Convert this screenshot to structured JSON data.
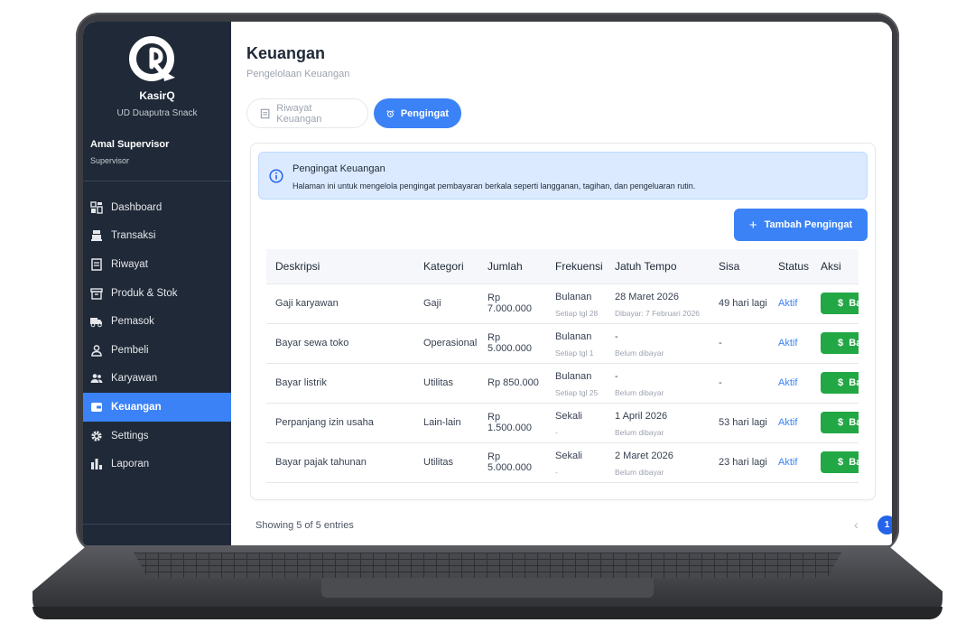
{
  "brand": {
    "name": "KasirQ",
    "subtitle": "UD Duaputra Snack"
  },
  "user": {
    "name": "Amal Supervisor",
    "role": "Supervisor"
  },
  "sidebar": {
    "items": [
      {
        "label": "Dashboard",
        "icon": "dashboard-icon"
      },
      {
        "label": "Transaksi",
        "icon": "cash-register-icon"
      },
      {
        "label": "Riwayat",
        "icon": "receipt-icon"
      },
      {
        "label": "Produk & Stok",
        "icon": "box-icon"
      },
      {
        "label": "Pemasok",
        "icon": "truck-icon"
      },
      {
        "label": "Pembeli",
        "icon": "user-icon"
      },
      {
        "label": "Karyawan",
        "icon": "users-icon"
      },
      {
        "label": "Keuangan",
        "icon": "wallet-icon",
        "active": true
      },
      {
        "label": "Settings",
        "icon": "gear-icon"
      },
      {
        "label": "Laporan",
        "icon": "bar-chart-icon"
      }
    ]
  },
  "page": {
    "title": "Keuangan",
    "subtitle": "Pengelolaan Keuangan"
  },
  "tabs": {
    "riwayat": "Riwayat Keuangan",
    "pengingat": "Pengingat"
  },
  "alert": {
    "title": "Pengingat Keuangan",
    "text": "Halaman ini untuk mengelola pengingat pembayaran berkala seperti langganan, tagihan, dan pengeluaran rutin."
  },
  "add_button": {
    "label": "Tambah Pengingat"
  },
  "table": {
    "headers": [
      "Deskripsi",
      "Kategori",
      "Jumlah",
      "Frekuensi",
      "Jatuh Tempo",
      "Sisa",
      "Status",
      "Aksi"
    ],
    "rows": [
      {
        "deskripsi": "Gaji karyawan",
        "kategori": "Gaji",
        "jumlah": "Rp 7.000.000",
        "frekuensi": "Bulanan",
        "frekuensi_detail": "Setiap tgl 28",
        "jatuh_tempo": "28 Maret 2026",
        "jatuh_tempo_detail": "Dibayar: 7 Februari 2026",
        "sisa": "49 hari lagi",
        "status": "Aktif",
        "aksi": "Ba"
      },
      {
        "deskripsi": "Bayar sewa toko",
        "kategori": "Operasional",
        "jumlah": "Rp 5.000.000",
        "frekuensi": "Bulanan",
        "frekuensi_detail": "Setiap tgl 1",
        "jatuh_tempo": "-",
        "jatuh_tempo_detail": "Belum dibayar",
        "sisa": "-",
        "status": "Aktif",
        "aksi": "Ba"
      },
      {
        "deskripsi": "Bayar listrik",
        "kategori": "Utilitas",
        "jumlah": "Rp 850.000",
        "frekuensi": "Bulanan",
        "frekuensi_detail": "Setiap tgl 25",
        "jatuh_tempo": "-",
        "jatuh_tempo_detail": "Belum dibayar",
        "sisa": "-",
        "status": "Aktif",
        "aksi": "Ba"
      },
      {
        "deskripsi": "Perpanjang izin usaha",
        "kategori": "Lain-lain",
        "jumlah": "Rp 1.500.000",
        "frekuensi": "Sekali",
        "frekuensi_detail": "-",
        "jatuh_tempo": "1 April 2026",
        "jatuh_tempo_detail": "Belum dibayar",
        "sisa": "53 hari lagi",
        "status": "Aktif",
        "aksi": "Ba"
      },
      {
        "deskripsi": "Bayar pajak tahunan",
        "kategori": "Utilitas",
        "jumlah": "Rp 5.000.000",
        "frekuensi": "Sekali",
        "frekuensi_detail": "-",
        "jatuh_tempo": "2 Maret 2026",
        "jatuh_tempo_detail": "Belum dibayar",
        "sisa": "23 hari lagi",
        "status": "Aktif",
        "aksi": "Ba"
      }
    ]
  },
  "footer": {
    "showing": "Showing 5 of 5 entries",
    "current_page": "1"
  },
  "colors": {
    "sidebar": "#1f2937",
    "accent": "#3b82f6",
    "success": "#22a745",
    "alert_bg": "#dbeafe"
  }
}
